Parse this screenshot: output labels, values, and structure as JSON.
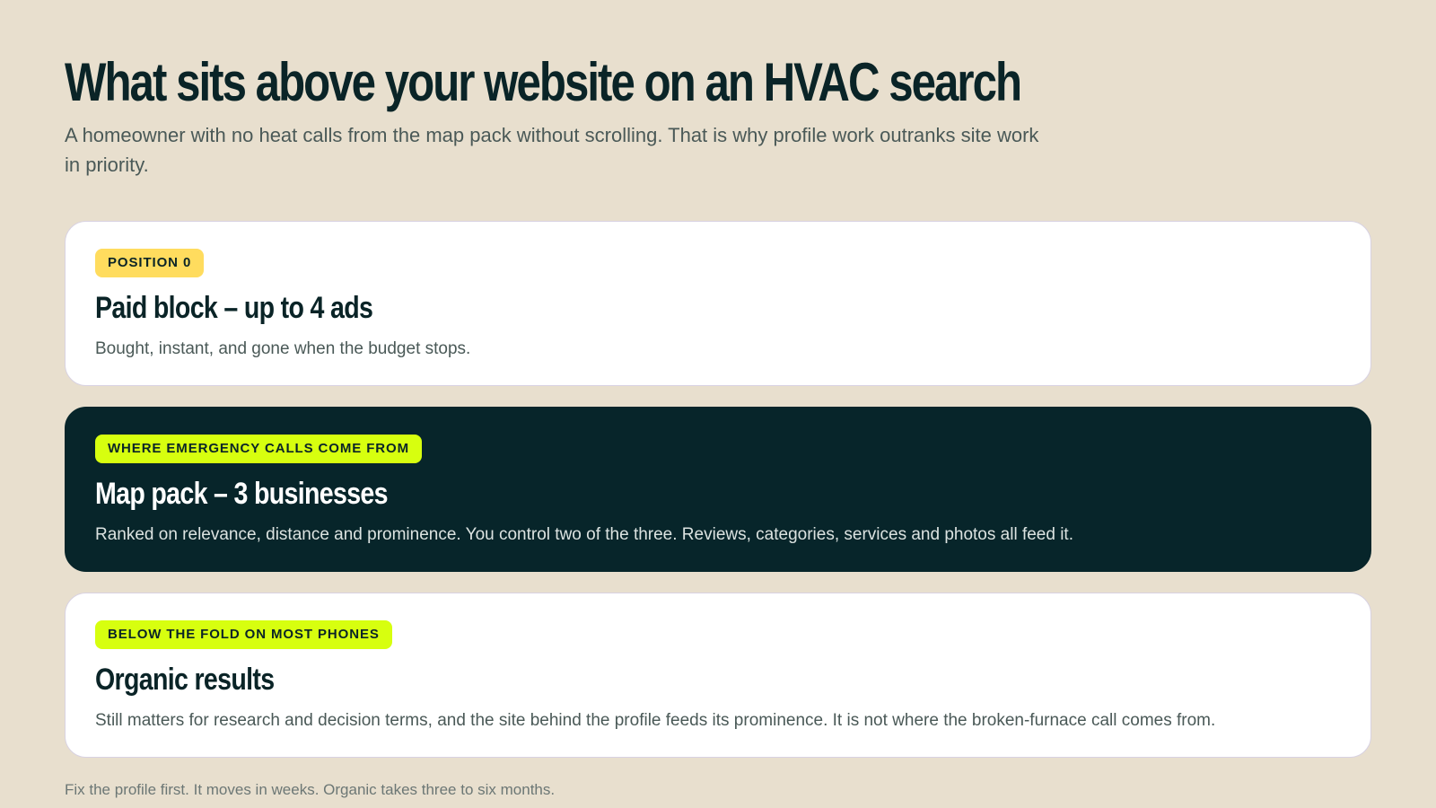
{
  "headline": "What sits above your website on an HVAC search",
  "subhead": "A homeowner with no heat calls from the map pack without scrolling. That is why profile work outranks site work in priority.",
  "cards": [
    {
      "badge": "POSITION 0",
      "title": "Paid block – up to 4 ads",
      "body": "Bought, instant, and gone when the budget stops.",
      "theme": "light",
      "badge_color": "#ffdc5e"
    },
    {
      "badge": "WHERE EMERGENCY CALLS COME FROM",
      "title": "Map pack – 3 businesses",
      "body": "Ranked on relevance, distance and prominence. You control two of the three. Reviews, categories, services and photos all feed it.",
      "theme": "dark",
      "badge_color": "#d7ff0f"
    },
    {
      "badge": "BELOW THE FOLD ON MOST PHONES",
      "title": "Organic results",
      "body": "Still matters for research and decision terms, and the site behind the profile feeds its prominence. It is not where the broken-furnace call comes from.",
      "theme": "light",
      "badge_color": "#d7ff0f"
    }
  ],
  "footnote": "Fix the profile first. It moves in weeks. Organic takes three to six months.",
  "colors": {
    "background": "#e8dfce",
    "dark_card": "#07252a",
    "ink": "#0a2427",
    "yellow_badge": "#ffdc5e",
    "lime_badge": "#d7ff0f"
  }
}
